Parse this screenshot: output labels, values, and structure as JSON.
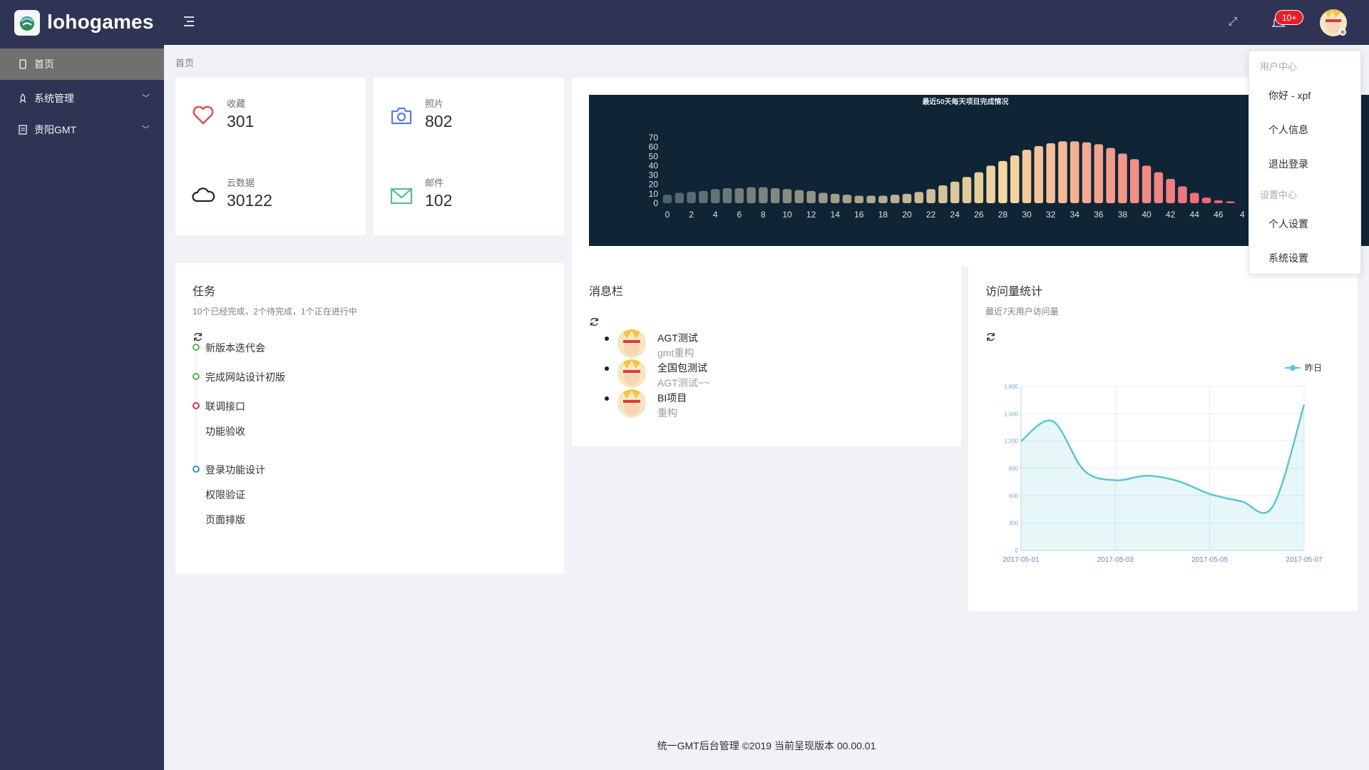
{
  "header": {
    "logo_text": "lohogames",
    "notification_badge": "10+"
  },
  "sidebar": {
    "items": [
      {
        "label": "首页",
        "icon": "phone-icon",
        "active": true
      },
      {
        "label": "系统管理",
        "icon": "rocket-icon",
        "expandable": true
      },
      {
        "label": "贵阳GMT",
        "icon": "document-icon",
        "expandable": true
      }
    ]
  },
  "breadcrumb": "首页",
  "stats": [
    {
      "label": "收藏",
      "value": "301",
      "icon": "heart-icon",
      "color": "#e5484d"
    },
    {
      "label": "照片",
      "value": "802",
      "icon": "camera-icon",
      "color": "#5b7be0"
    },
    {
      "label": "云数据",
      "value": "30122",
      "icon": "cloud-icon",
      "color": "#222222"
    },
    {
      "label": "邮件",
      "value": "102",
      "icon": "mail-icon",
      "color": "#5bbf8a"
    }
  ],
  "bar_chart_panel": {
    "chart_data": {
      "type": "bar",
      "title": "最近50天每天项目完成情况",
      "x_tick_labels": [
        "0",
        "2",
        "4",
        "6",
        "8",
        "10",
        "12",
        "14",
        "16",
        "18",
        "20",
        "22",
        "24",
        "26",
        "28",
        "30",
        "32",
        "34",
        "36",
        "38",
        "40",
        "42",
        "44",
        "46",
        "4"
      ],
      "y_tick_labels": [
        "70",
        "60",
        "50",
        "40",
        "30",
        "20",
        "10",
        "0"
      ],
      "ylim": [
        0,
        70
      ],
      "categories": [
        0,
        1,
        2,
        3,
        4,
        5,
        6,
        7,
        8,
        9,
        10,
        11,
        12,
        13,
        14,
        15,
        16,
        17,
        18,
        19,
        20,
        21,
        22,
        23,
        24,
        25,
        26,
        27,
        28,
        29,
        30,
        31,
        32,
        33,
        34,
        35,
        36,
        37,
        38,
        39,
        40,
        41,
        42,
        43,
        44,
        45,
        46,
        47
      ],
      "values": [
        9,
        11,
        12,
        13,
        15,
        16,
        16,
        17,
        17,
        16,
        15,
        14,
        13,
        11,
        10,
        9,
        8,
        8,
        8,
        9,
        10,
        12,
        15,
        19,
        23,
        28,
        33,
        40,
        45,
        51,
        57,
        61,
        64,
        66,
        66,
        65,
        63,
        59,
        53,
        47,
        40,
        33,
        26,
        18,
        11,
        6,
        3,
        2
      ],
      "background": "#0f2535",
      "bar_color_start": "#4d6370",
      "bar_color_mid": "#f5d7a2",
      "bar_color_end": "#ef5c72"
    }
  },
  "tasks": {
    "title": "任务",
    "subtitle": "10个已经完成，2个待完成，1个正在进行中",
    "items": [
      {
        "label": "新版本迭代会",
        "dot": "#53b25b"
      },
      {
        "label": "完成网站设计初版",
        "dot": "#53b25b"
      },
      {
        "label": "联调接口",
        "dot": "#d33340"
      },
      {
        "label": "功能验收",
        "dot": ""
      },
      {
        "label": "登录功能设计",
        "dot": "#3a8fd6"
      },
      {
        "label": "权限验证",
        "dot": ""
      },
      {
        "label": "页面排版",
        "dot": ""
      }
    ]
  },
  "messages": {
    "title": "消息栏",
    "items": [
      {
        "title": "AGT测试",
        "desc": "gmt重构"
      },
      {
        "title": "全国包测试",
        "desc": "AGT测试~~"
      },
      {
        "title": "BI项目",
        "desc": "重构"
      }
    ]
  },
  "visits": {
    "title": "访问量统计",
    "subtitle": "最近7天用户访问量",
    "chart_data": {
      "type": "area",
      "series": [
        {
          "name": "昨日",
          "values": [
            1200,
            1420,
            880,
            770,
            820,
            760,
            620,
            540,
            480,
            1600
          ]
        }
      ],
      "x": [
        0,
        1,
        2,
        3,
        4,
        5,
        6,
        7,
        8,
        9
      ],
      "x_tick_labels": [
        "2017-05-01",
        "2017-05-03",
        "2017-05-05",
        "2017-05-07"
      ],
      "y_tick_labels": [
        "1,800",
        "1,500",
        "1,200",
        "900",
        "600",
        "300",
        "0"
      ],
      "ylim": [
        0,
        1800
      ],
      "color": "#5bc6d1"
    }
  },
  "dropdown": {
    "group1": "用户中心",
    "items1": [
      "你好 - xpf",
      "个人信息",
      "退出登录"
    ],
    "group2": "设置中心",
    "items2": [
      "个人设置",
      "系统设置"
    ]
  },
  "footer": "统一GMT后台管理 ©2019 当前呈现版本 00.00.01"
}
